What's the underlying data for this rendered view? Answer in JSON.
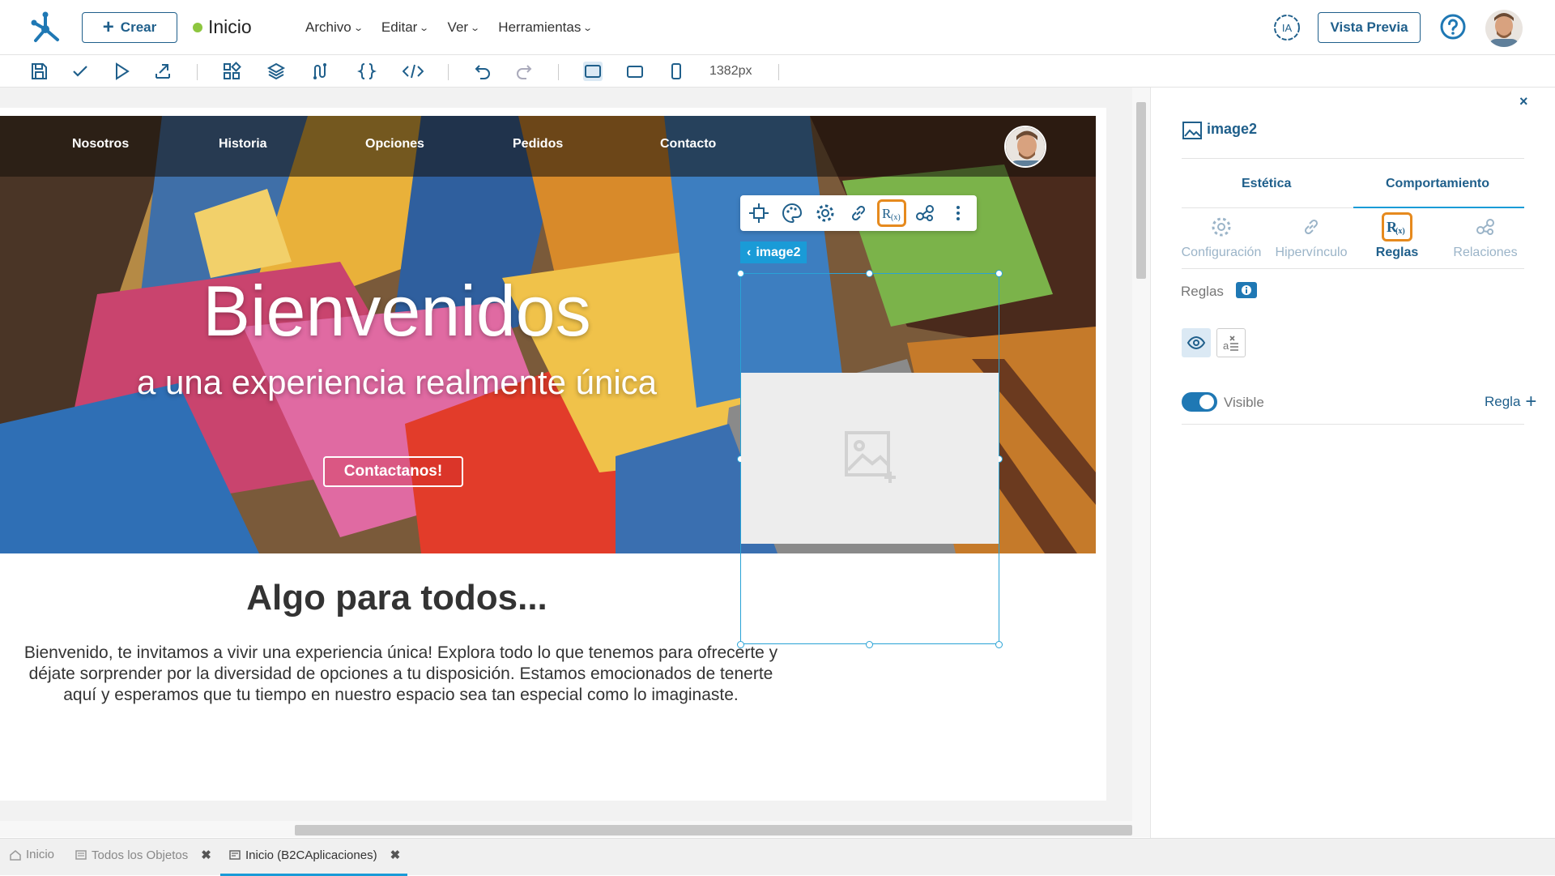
{
  "header": {
    "create_label": "Crear",
    "page_name": "Inicio",
    "menu": [
      {
        "label": "Archivo"
      },
      {
        "label": "Editar"
      },
      {
        "label": "Ver"
      },
      {
        "label": "Herramientas"
      }
    ],
    "ai_label": "IA",
    "preview_label": "Vista Previa"
  },
  "toolbar": {
    "width_readout": "1382px"
  },
  "site": {
    "nav": [
      "Nosotros",
      "Historia",
      "Opciones",
      "Pedidos",
      "Contacto"
    ],
    "hero_title": "Bienvenidos",
    "hero_subtitle": "a una experiencia realmente única",
    "hero_button": "Contactanos!",
    "section_title": "Algo para todos...",
    "section_text_1": "Bienvenido, te invitamos a vivir una experiencia única! Explora todo lo que tenemos para ofrecerte y",
    "section_text_2": "déjate sorprender por la diversidad de opciones a tu disposición. Estamos emocionados de tenerte",
    "section_text_3": "aquí y esperamos que tu tiempo en nuestro espacio sea tan especial como lo imaginaste."
  },
  "selection": {
    "label": "image2"
  },
  "panel": {
    "close": "×",
    "title": "image2",
    "tabs": [
      {
        "label": "Estética"
      },
      {
        "label": "Comportamiento",
        "active": true
      }
    ],
    "subtabs": [
      {
        "label": "Configuración",
        "icon": "gear-icon"
      },
      {
        "label": "Hipervínculo",
        "icon": "link-icon"
      },
      {
        "label": "Reglas",
        "icon": "rules-icon",
        "active": true
      },
      {
        "label": "Relaciones",
        "icon": "relations-icon"
      }
    ],
    "rules_label": "Reglas",
    "visible_label": "Visible",
    "visible_on": true,
    "add_rule_label": "Regla"
  },
  "bottom_tabs": [
    {
      "label": "Inicio",
      "icon": "home-icon"
    },
    {
      "label": "Todos los Objetos",
      "icon": "list-icon",
      "closable": true
    },
    {
      "label": "Inicio (B2CAplicaciones)",
      "icon": "page-icon",
      "closable": true,
      "active": true
    }
  ],
  "colors": {
    "brand": "#1f5f8b",
    "accent": "#1a9bd7",
    "highlight": "#e68a1e"
  }
}
